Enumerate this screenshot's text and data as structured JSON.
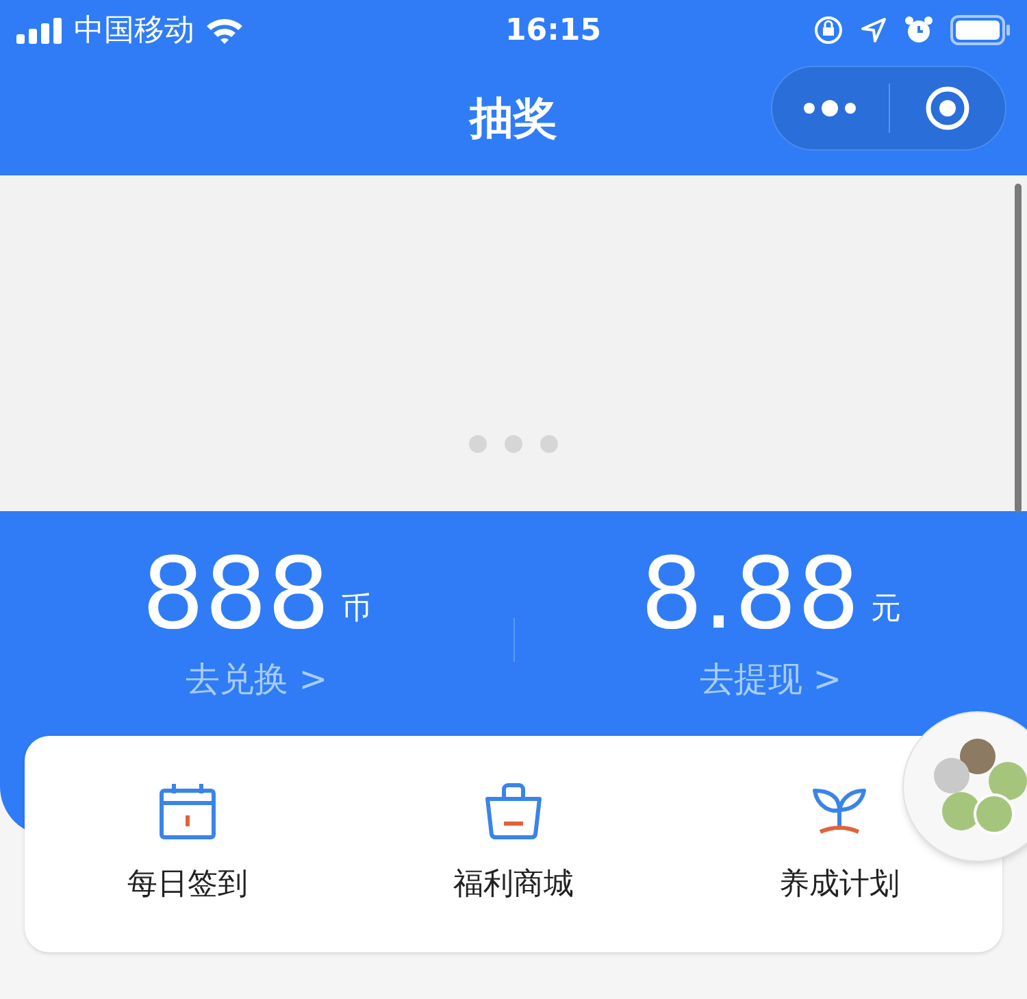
{
  "status_bar": {
    "carrier": "中国移动",
    "time": "16:15"
  },
  "nav": {
    "title": "抽奖"
  },
  "balances": [
    {
      "amount": "888",
      "unit": "币",
      "action": "去兑换 >"
    },
    {
      "amount": "8.88",
      "unit": "元",
      "action": "去提现 >"
    }
  ],
  "shortcuts": [
    {
      "kind": "calendar",
      "label": "每日签到"
    },
    {
      "kind": "bag",
      "label": "福利商城"
    },
    {
      "kind": "sprout",
      "label": "养成计划"
    }
  ]
}
